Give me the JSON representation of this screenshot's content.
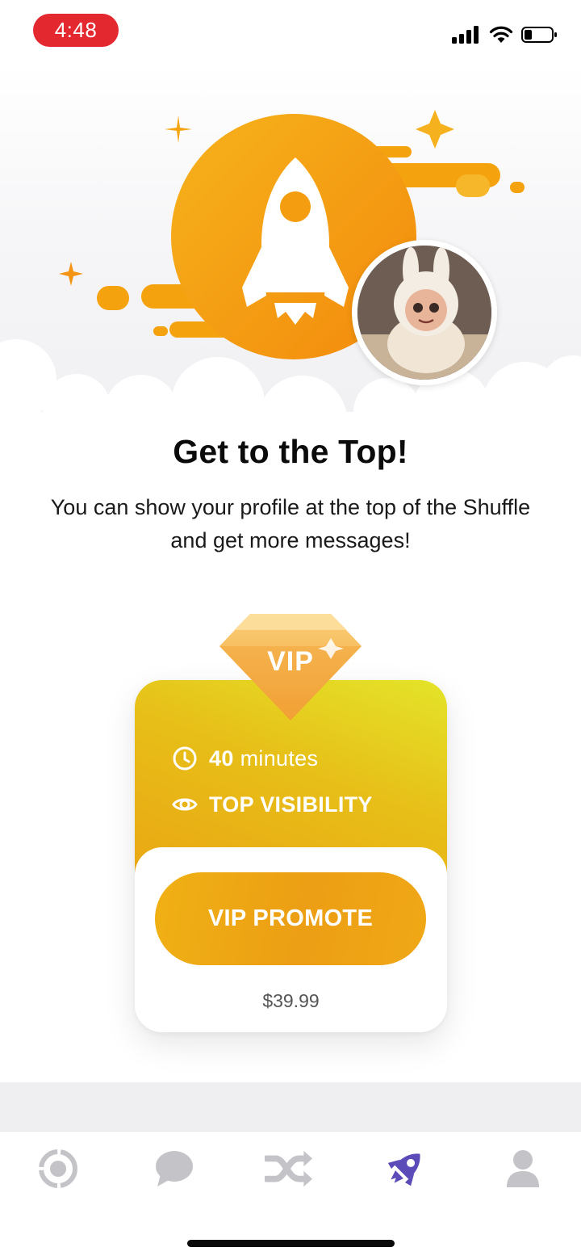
{
  "status_bar": {
    "time": "4:48",
    "time_pill_color": "#e3282f"
  },
  "hero": {
    "icon": "rocket-icon",
    "accent": "#f6a50f",
    "avatar": "user-avatar"
  },
  "headline": "Get to the Top!",
  "subtitle": "You can show your profile at the top of the Shuffle and get more messages!",
  "vip_card": {
    "badge_label": "VIP",
    "duration_value": "40",
    "duration_unit": "minutes",
    "feature_label": "TOP VISIBILITY",
    "button_label": "VIP PROMOTE",
    "price": "$39.99",
    "colors": {
      "gradient_start": "#e4e42a",
      "gradient_end": "#eaa613"
    }
  },
  "tab_bar": {
    "active_color": "#5b4bb8",
    "inactive_color": "#c4c4c8",
    "tabs": [
      {
        "icon": "discover-icon",
        "active": false
      },
      {
        "icon": "chat-icon",
        "active": false
      },
      {
        "icon": "shuffle-icon",
        "active": false
      },
      {
        "icon": "rocket-icon",
        "active": true
      },
      {
        "icon": "profile-icon",
        "active": false
      }
    ]
  }
}
